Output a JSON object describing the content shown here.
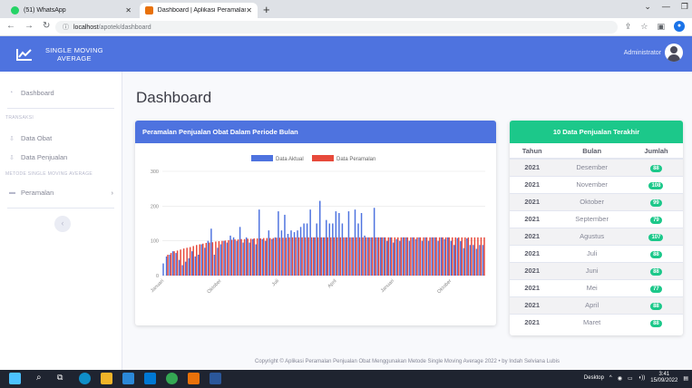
{
  "browser": {
    "tabs": [
      {
        "label": "(51) WhatsApp",
        "icon": "whatsapp-icon"
      },
      {
        "label": "Dashboard | Aplikasi Peramalan",
        "icon": "app-icon"
      }
    ],
    "url_host": "localhost",
    "url_path": "/apotek/dashboard"
  },
  "header": {
    "brand_line1": "SINGLE MOVING",
    "brand_line2": "AVERAGE",
    "user": "Administrator"
  },
  "sidebar": {
    "dashboard": "Dashboard",
    "section_transaksi": "TRANSAKSI",
    "data_obat": "Data Obat",
    "data_penjualan": "Data Penjualan",
    "section_sma": "METODE SINGLE MOVING AVERAGE",
    "peramalan": "Peramalan"
  },
  "main": {
    "title": "Dashboard",
    "chart_title": "Peramalan Penjualan Obat Dalam Periode Bulan",
    "table_title": "10 Data Penjualan Terakhir",
    "table_headers": [
      "Tahun",
      "Bulan",
      "Jumlah"
    ],
    "table_rows": [
      {
        "tahun": "2021",
        "bulan": "Desember",
        "jumlah": "88"
      },
      {
        "tahun": "2021",
        "bulan": "November",
        "jumlah": "108"
      },
      {
        "tahun": "2021",
        "bulan": "Oktober",
        "jumlah": "99"
      },
      {
        "tahun": "2021",
        "bulan": "September",
        "jumlah": "79"
      },
      {
        "tahun": "2021",
        "bulan": "Agustus",
        "jumlah": "107"
      },
      {
        "tahun": "2021",
        "bulan": "Juli",
        "jumlah": "88"
      },
      {
        "tahun": "2021",
        "bulan": "Juni",
        "jumlah": "88"
      },
      {
        "tahun": "2021",
        "bulan": "Mei",
        "jumlah": "77"
      },
      {
        "tahun": "2021",
        "bulan": "April",
        "jumlah": "88"
      },
      {
        "tahun": "2021",
        "bulan": "Maret",
        "jumlah": "88"
      }
    ],
    "footer": "Copyright © Aplikasi Peramalan Penjualan Obat Menggunakan Metode Single Moving Average 2022 • by Indah Selviana Lubis"
  },
  "taskbar": {
    "desktop": "Desktop",
    "time": "3:41",
    "date": "15/09/2022"
  },
  "colors": {
    "primary": "#4e73df",
    "success": "#1cc88a",
    "actual": "#4e73df",
    "forecast": "#e74a3b"
  },
  "chart_data": {
    "type": "bar",
    "ylim": [
      0,
      300
    ],
    "yticks": [
      0,
      100,
      200,
      300
    ],
    "xtick_labels": [
      "Januari",
      "Oktober",
      "Juli",
      "April",
      "Januari",
      "Oktober",
      "Juli"
    ],
    "series": [
      {
        "name": "Data Aktual",
        "values": [
          35,
          55,
          60,
          70,
          65,
          45,
          30,
          40,
          50,
          70,
          55,
          60,
          90,
          80,
          100,
          135,
          60,
          80,
          90,
          100,
          95,
          115,
          110,
          100,
          140,
          95,
          110,
          95,
          105,
          90,
          190,
          105,
          100,
          130,
          105,
          110,
          185,
          130,
          175,
          120,
          130,
          125,
          130,
          140,
          150,
          150,
          190,
          110,
          150,
          215,
          110,
          160,
          150,
          150,
          185,
          180,
          150,
          110,
          185,
          110,
          190,
          150,
          180,
          115,
          110,
          110,
          195,
          110,
          110,
          110,
          100,
          110,
          95,
          105,
          100,
          110,
          110,
          100,
          110,
          105,
          110,
          100,
          110,
          100,
          110,
          110,
          100,
          110,
          105,
          110,
          100,
          88,
          108,
          99,
          79,
          107,
          88,
          88,
          77,
          88,
          88
        ]
      },
      {
        "name": "Data Peramalan",
        "values": [
          0,
          60,
          65,
          70,
          72,
          75,
          78,
          80,
          82,
          85,
          88,
          90,
          92,
          94,
          95,
          96,
          98,
          99,
          100,
          101,
          102,
          103,
          104,
          104,
          105,
          105,
          106,
          106,
          107,
          107,
          107,
          108,
          108,
          108,
          108,
          109,
          109,
          109,
          109,
          110,
          110,
          110,
          110,
          110,
          110,
          110,
          110,
          110,
          110,
          110,
          110,
          110,
          110,
          110,
          110,
          110,
          110,
          110,
          110,
          110,
          110,
          110,
          110,
          110,
          110,
          110,
          110,
          110,
          110,
          110,
          110,
          110,
          110,
          110,
          110,
          110,
          110,
          110,
          110,
          110,
          110,
          110,
          110,
          110,
          110,
          110,
          110,
          110,
          110,
          110,
          110,
          110,
          110,
          110,
          110,
          110,
          110,
          110,
          110,
          110,
          110
        ]
      }
    ]
  }
}
